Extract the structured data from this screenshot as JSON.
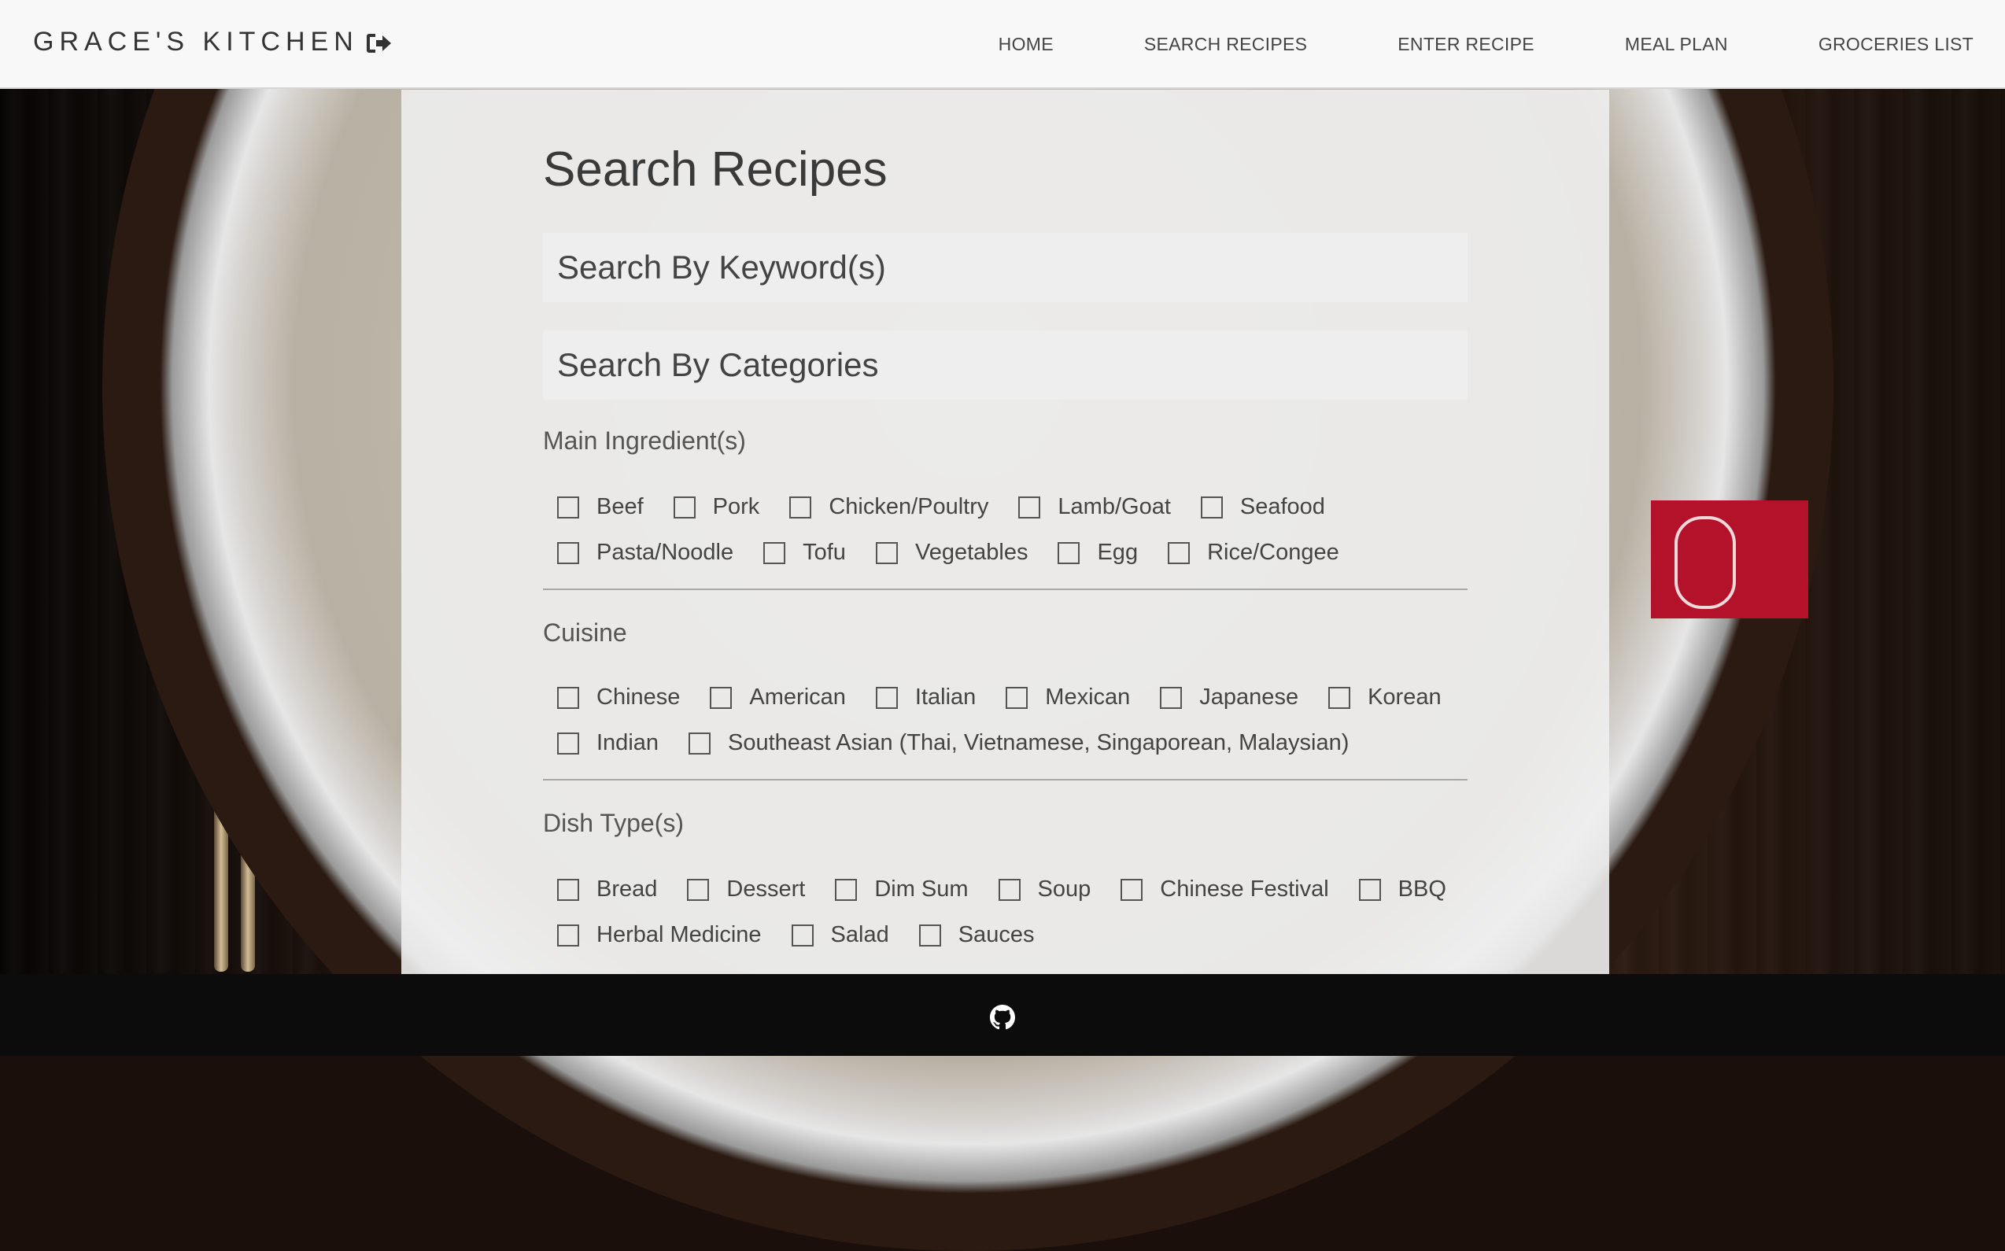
{
  "brand": "GRACE'S KITCHEN",
  "icons": {
    "logout": "sign-out-icon",
    "github": "github-icon"
  },
  "nav": [
    "HOME",
    "SEARCH RECIPES",
    "ENTER RECIPE",
    "MEAL PLAN",
    "GROCERIES LIST"
  ],
  "page_title": "Search Recipes",
  "search": {
    "keyword_placeholder": "Search By Keyword(s)",
    "categories_placeholder": "Search By Categories"
  },
  "sections": {
    "main_ingredients": {
      "title": "Main Ingredient(s)",
      "rows": [
        [
          "Beef",
          "Pork",
          "Chicken/Poultry",
          "Lamb/Goat",
          "Seafood"
        ],
        [
          "Pasta/Noodle",
          "Tofu",
          "Vegetables",
          "Egg",
          "Rice/Congee"
        ]
      ]
    },
    "cuisine": {
      "title": "Cuisine",
      "rows": [
        [
          "Chinese",
          "American",
          "Italian",
          "Mexican",
          "Japanese",
          "Korean"
        ],
        [
          "Indian",
          "Southeast Asian (Thai, Vietnamese, Singaporean, Malaysian)"
        ]
      ]
    },
    "dish_types": {
      "title": "Dish Type(s)",
      "rows": [
        [
          "Bread",
          "Dessert",
          "Dim Sum",
          "Soup",
          "Chinese Festival",
          "BBQ"
        ],
        [
          "Herbal Medicine",
          "Salad",
          "Sauces"
        ]
      ]
    }
  },
  "colors": {
    "topbar": "#f8f8f8",
    "panel": "#eeeeee",
    "footer": "#0c0c0c",
    "text": "#444444"
  }
}
